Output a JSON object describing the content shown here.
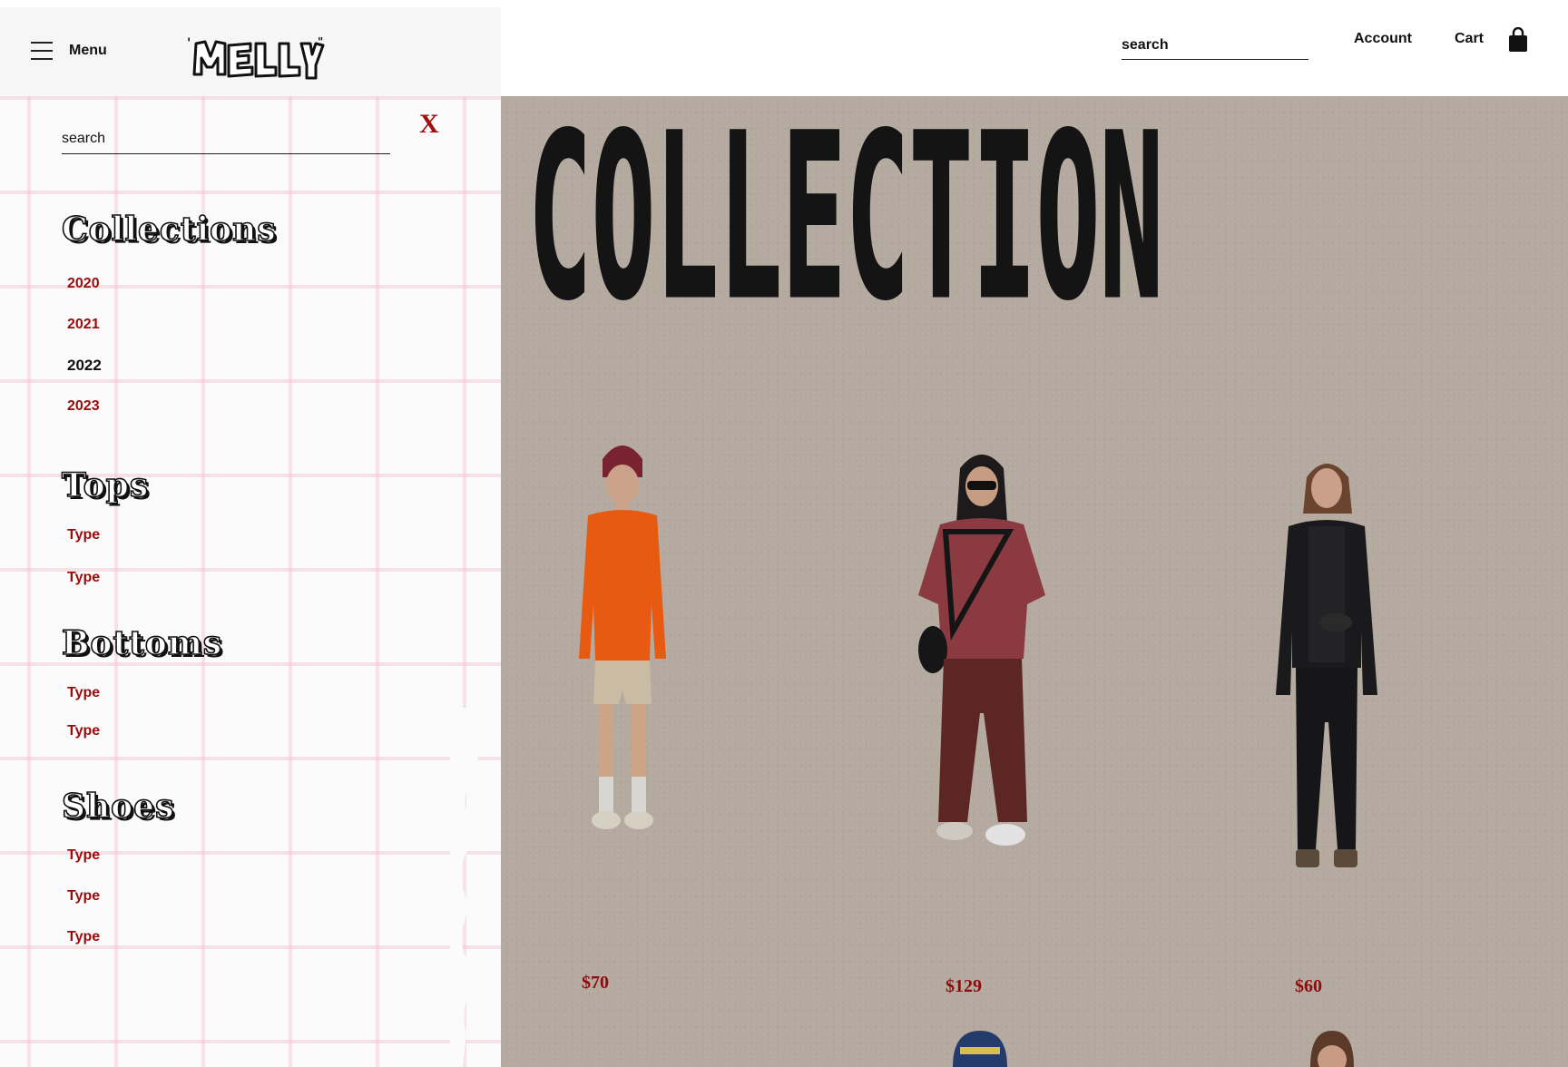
{
  "header": {
    "menu_label": "Menu",
    "brand": "MELLY",
    "search_placeholder": "search",
    "account_label": "Account",
    "cart_label": "Cart"
  },
  "main": {
    "title": "COLLECTION",
    "products": [
      {
        "price": "$70"
      },
      {
        "price": "$129"
      },
      {
        "price": "$60"
      }
    ]
  },
  "sidebar": {
    "search_placeholder": "search",
    "close_label": "X",
    "sections": [
      {
        "title": "Collections",
        "items": [
          "2020",
          "2021",
          "2022",
          "2023"
        ]
      },
      {
        "title": "Tops",
        "items": [
          "Type",
          "Type"
        ]
      },
      {
        "title": "Bottoms",
        "items": [
          "Type",
          "Type"
        ]
      },
      {
        "title": "Shoes",
        "items": [
          "Type",
          "Type",
          "Type"
        ]
      }
    ],
    "active_item": "2022"
  },
  "colors": {
    "accent": "#9a0b0b",
    "background": "#b5aaa0",
    "grid": "#f0c4cc"
  }
}
